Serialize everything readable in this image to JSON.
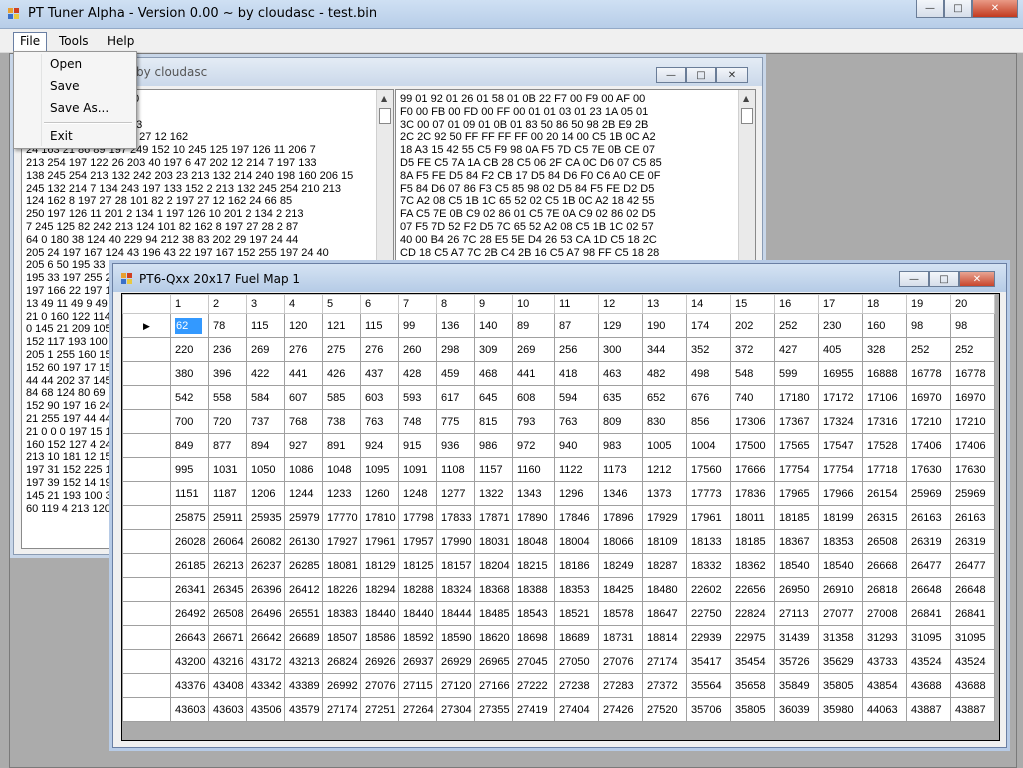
{
  "main_window": {
    "title": "PT Tuner Alpha - Version 0.00 ~ by cloudasc - test.bin",
    "menu": [
      "File",
      "Tools",
      "Help"
    ]
  },
  "file_menu": {
    "items": [
      "Open",
      "Save",
      "Save As...",
      "Exit"
    ]
  },
  "hex_window": {
    "title_fragment": "by cloudasc",
    "left_lines": [
      "1 34 247 0 249 0 175 0",
      "0 1 1 3 1 35 26 5 1",
      "0 134 80 152 43 233 43",
      "255 255 0 32 20 0 197 27 12 162",
      "24 163 21 86 89 197 249 152 10 245 125 197 126 11 206 7",
      "213 254 197 122 26 203 40 197 6 47 202 12 214 7 197 133",
      "138 245 254 213 132 242 203 23 213 132 214 240 198 160 206 15",
      "245 132 214 7 134 243 197 133 152 2 213 132 245 254 210 213",
      "124 162 8 197 27 28 101 82 2 197 27 12 162 24 66 85",
      "250 197 126 11 201 2 134 1 197 126 10 201 2 134 2 213",
      "7 245 125 82 242 213 124 101 82 162 8 197 27 28 2 87",
      "64 0 180 38 124 40 229 94 212 38 83 202 29 197 24 44",
      "205 24 197 167 124 43 196 43 22 197 167 152 255 197 24 40",
      "205 6 50 195 33 1",
      "195 33 197 255 2",
      "197 166 22 197 1",
      "13 49 11 49 9 49",
      "21 0 160 122 114",
      "0 145 21 209 105",
      "152 117 193 100 3",
      "205 1 255 160 152",
      "152 60 197 17 152",
      "44 44 202 37 145",
      "84 68 124 80 69 1",
      "152 90 197 16 24",
      "21 255 197 44 44",
      "21 0 0 0 197 15 1",
      "160 152 127 4 245",
      "213 10 181 12 152",
      "197 31 152 225 15",
      "197 39 152 14 197",
      "145 21 193 100 3",
      "60 119 4 213 120"
    ],
    "right_lines": [
      "99 01 92 01 26 01 58 01 0B 22 F7 00 F9 00 AF 00",
      "F0 00 FB 00 FD 00 FF 00 01 01 03 01 23 1A 05 01",
      "3C 00 07 01 09 01 0B 01 83 50 86 50 98 2B E9 2B",
      "2C 2C 92 50 FF FF FF FF 00 20 14 00 C5 1B 0C A2",
      "18 A3 15 42 55 C5 F9 98 0A F5 7D C5 7E 0B CE 07",
      "D5 FE C5 7A 1A CB 28 C5 06 2F CA 0C D6 07 C5 85",
      "8A F5 FE D5 84 F2 CB 17 D5 84 D6 F0 C6 A0 CE 0F",
      "F5 84 D6 07 86 F3 C5 85 98 02 D5 84 F5 FE D2 D5",
      "7C A2 08 C5 1B 1C 65 52 02 C5 1B 0C A2 18 42 55",
      "FA C5 7E 0B C9 02 86 01 C5 7E 0A C9 02 86 02 D5",
      "07 F5 7D 52 F2 D5 7C 65 52 A2 08 C5 1B 1C 02 57",
      "40 00 B4 26 7C 28 E5 5E D4 26 53 CA 1D C5 18 2C",
      "CD 18 C5 A7 7C 2B C4 2B 16 C5 A7 98 FF C5 18 28"
    ]
  },
  "fuel_window": {
    "title": "PT6-Qxx 20x17 Fuel Map 1",
    "columns": [
      "1",
      "2",
      "3",
      "4",
      "5",
      "6",
      "7",
      "8",
      "9",
      "10",
      "11",
      "12",
      "13",
      "14",
      "15",
      "16",
      "17",
      "18",
      "19",
      "20"
    ],
    "row_marker": "▶",
    "rows": [
      [
        62,
        78,
        115,
        120,
        121,
        115,
        99,
        136,
        140,
        89,
        87,
        129,
        190,
        174,
        202,
        252,
        230,
        160,
        98,
        98
      ],
      [
        220,
        236,
        269,
        276,
        275,
        276,
        260,
        298,
        309,
        269,
        256,
        300,
        344,
        352,
        372,
        427,
        405,
        328,
        252,
        252
      ],
      [
        380,
        396,
        422,
        441,
        426,
        437,
        428,
        459,
        468,
        441,
        418,
        463,
        482,
        498,
        548,
        599,
        16955,
        16888,
        16778,
        16778
      ],
      [
        542,
        558,
        584,
        607,
        585,
        603,
        593,
        617,
        645,
        608,
        594,
        635,
        652,
        676,
        740,
        17180,
        17172,
        17106,
        16970,
        16970
      ],
      [
        700,
        720,
        737,
        768,
        738,
        763,
        748,
        775,
        815,
        793,
        763,
        809,
        830,
        856,
        17306,
        17367,
        17324,
        17316,
        17210,
        17210
      ],
      [
        849,
        877,
        894,
        927,
        891,
        924,
        915,
        936,
        986,
        972,
        940,
        983,
        1005,
        1004,
        17500,
        17565,
        17547,
        17528,
        17406,
        17406
      ],
      [
        995,
        1031,
        1050,
        1086,
        1048,
        1095,
        1091,
        1108,
        1157,
        1160,
        1122,
        1173,
        1212,
        17560,
        17666,
        17754,
        17754,
        17718,
        17630,
        17630
      ],
      [
        1151,
        1187,
        1206,
        1244,
        1233,
        1260,
        1248,
        1277,
        1322,
        1343,
        1296,
        1346,
        1373,
        17773,
        17836,
        17965,
        17966,
        26154,
        25969,
        25969
      ],
      [
        25875,
        25911,
        25935,
        25979,
        17770,
        17810,
        17798,
        17833,
        17871,
        17890,
        17846,
        17896,
        17929,
        17961,
        18011,
        18185,
        18199,
        26315,
        26163,
        26163
      ],
      [
        26028,
        26064,
        26082,
        26130,
        17927,
        17961,
        17957,
        17990,
        18031,
        18048,
        18004,
        18066,
        18109,
        18133,
        18185,
        18367,
        18353,
        26508,
        26319,
        26319
      ],
      [
        26185,
        26213,
        26237,
        26285,
        18081,
        18129,
        18125,
        18157,
        18204,
        18215,
        18186,
        18249,
        18287,
        18332,
        18362,
        18540,
        18540,
        26668,
        26477,
        26477
      ],
      [
        26341,
        26345,
        26396,
        26412,
        18226,
        18294,
        18288,
        18324,
        18368,
        18388,
        18353,
        18425,
        18480,
        22602,
        22656,
        26950,
        26910,
        26818,
        26648,
        26648
      ],
      [
        26492,
        26508,
        26496,
        26551,
        18383,
        18440,
        18440,
        18444,
        18485,
        18543,
        18521,
        18578,
        18647,
        22750,
        22824,
        27113,
        27077,
        27008,
        26841,
        26841
      ],
      [
        26643,
        26671,
        26642,
        26689,
        18507,
        18586,
        18592,
        18590,
        18620,
        18698,
        18689,
        18731,
        18814,
        22939,
        22975,
        31439,
        31358,
        31293,
        31095,
        31095
      ],
      [
        43200,
        43216,
        43172,
        43213,
        26824,
        26926,
        26937,
        26929,
        26965,
        27045,
        27050,
        27076,
        27174,
        35417,
        35454,
        35726,
        35629,
        43733,
        43524,
        43524
      ],
      [
        43376,
        43408,
        43342,
        43389,
        26992,
        27076,
        27115,
        27120,
        27166,
        27222,
        27238,
        27283,
        27372,
        35564,
        35658,
        35849,
        35805,
        43854,
        43688,
        43688
      ],
      [
        43603,
        43603,
        43506,
        43579,
        27174,
        27251,
        27264,
        27304,
        27355,
        27419,
        27404,
        27426,
        27520,
        35706,
        35805,
        36039,
        35980,
        44063,
        43887,
        43887
      ]
    ]
  },
  "window_buttons": {
    "minimize": "—",
    "maximize": "□",
    "close": "✕"
  }
}
